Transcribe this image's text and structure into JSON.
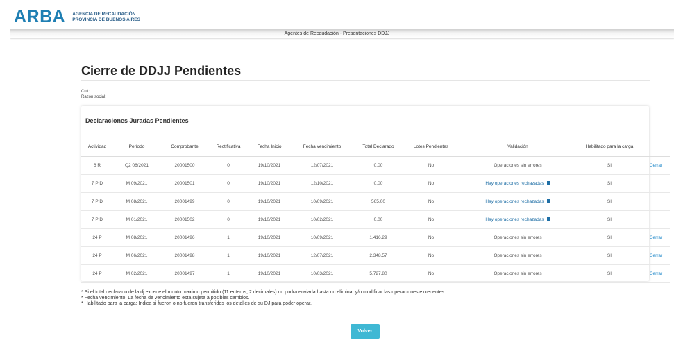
{
  "header": {
    "logo_mark": "ARBA",
    "logo_line1": "AGENCIA DE RECAUDACIÓN",
    "logo_line2": "PROVINCIA DE BUENOS AIRES",
    "title": "Agentes de Recaudación - Presentaciones DDJJ"
  },
  "page": {
    "title": "Cierre de DDJJ Pendientes",
    "cuit_label": "Cuit:",
    "razon_label": "Razón social:"
  },
  "card": {
    "title": "Declaraciones Juradas Pendientes",
    "columns": [
      "Actividad",
      "Período",
      "Comprobante",
      "Rectificativa",
      "Fecha Inicio",
      "Fecha vencimiento",
      "Total Declarado",
      "Lotes Pendientes",
      "Validación",
      "Habilitado para la carga",
      ""
    ],
    "rows": [
      {
        "actividad": "6 R",
        "periodo": "Q2 06/2021",
        "comprobante": "20001500",
        "rectificativa": "0",
        "inicio": "19/10/2021",
        "vencimiento": "12/07/2021",
        "total": "0,00",
        "lotes": "No",
        "validacion": "Operaciones sin errores",
        "habilitado": "SI",
        "accion": "Cerrar"
      },
      {
        "actividad": "7 P D",
        "periodo": "M 09/2021",
        "comprobante": "20001501",
        "rectificativa": "0",
        "inicio": "19/10/2021",
        "vencimiento": "12/10/2021",
        "total": "0,00",
        "lotes": "No",
        "validacion": "Hay operaciones rechazadas",
        "habilitado": "SI",
        "accion": ""
      },
      {
        "actividad": "7 P D",
        "periodo": "M 08/2021",
        "comprobante": "20001499",
        "rectificativa": "0",
        "inicio": "19/10/2021",
        "vencimiento": "10/09/2021",
        "total": "565,00",
        "lotes": "No",
        "validacion": "Hay operaciones rechazadas",
        "habilitado": "SI",
        "accion": ""
      },
      {
        "actividad": "7 P D",
        "periodo": "M 01/2021",
        "comprobante": "20001502",
        "rectificativa": "0",
        "inicio": "19/10/2021",
        "vencimiento": "10/02/2021",
        "total": "0,00",
        "lotes": "No",
        "validacion": "Hay operaciones rechazadas",
        "habilitado": "SI",
        "accion": ""
      },
      {
        "actividad": "24 P",
        "periodo": "M 08/2021",
        "comprobante": "20001496",
        "rectificativa": "1",
        "inicio": "19/10/2021",
        "vencimiento": "10/09/2021",
        "total": "1.416,29",
        "lotes": "No",
        "validacion": "Operaciones sin errores",
        "habilitado": "SI",
        "accion": "Cerrar"
      },
      {
        "actividad": "24 P",
        "periodo": "M 06/2021",
        "comprobante": "20001498",
        "rectificativa": "1",
        "inicio": "19/10/2021",
        "vencimiento": "12/07/2021",
        "total": "2.348,57",
        "lotes": "No",
        "validacion": "Operaciones sin errores",
        "habilitado": "SI",
        "accion": "Cerrar"
      },
      {
        "actividad": "24 P",
        "periodo": "M 02/2021",
        "comprobante": "20001497",
        "rectificativa": "1",
        "inicio": "19/10/2021",
        "vencimiento": "10/03/2021",
        "total": "5.727,80",
        "lotes": "No",
        "validacion": "Operaciones sin errores",
        "habilitado": "SI",
        "accion": "Cerrar"
      }
    ]
  },
  "notes": [
    "* Si el total declarado de la dj excede el monto maximo permitido (11 enteros, 2 decimales) no podra enviarla hasta no eliminar y/o modificar las operaciones excedentes.",
    "* Fecha vencimiento: La fecha de vencimiento esta sujeta a posibles cambios.",
    "* Habilitado para la carga: Indica si fueron o no fueron transferidos los detalles de su DJ para poder operar."
  ],
  "volver_label": "Volver",
  "colors": {
    "brand": "#1f7fb3",
    "link": "#1f88c9",
    "button": "#3fb8d4"
  }
}
